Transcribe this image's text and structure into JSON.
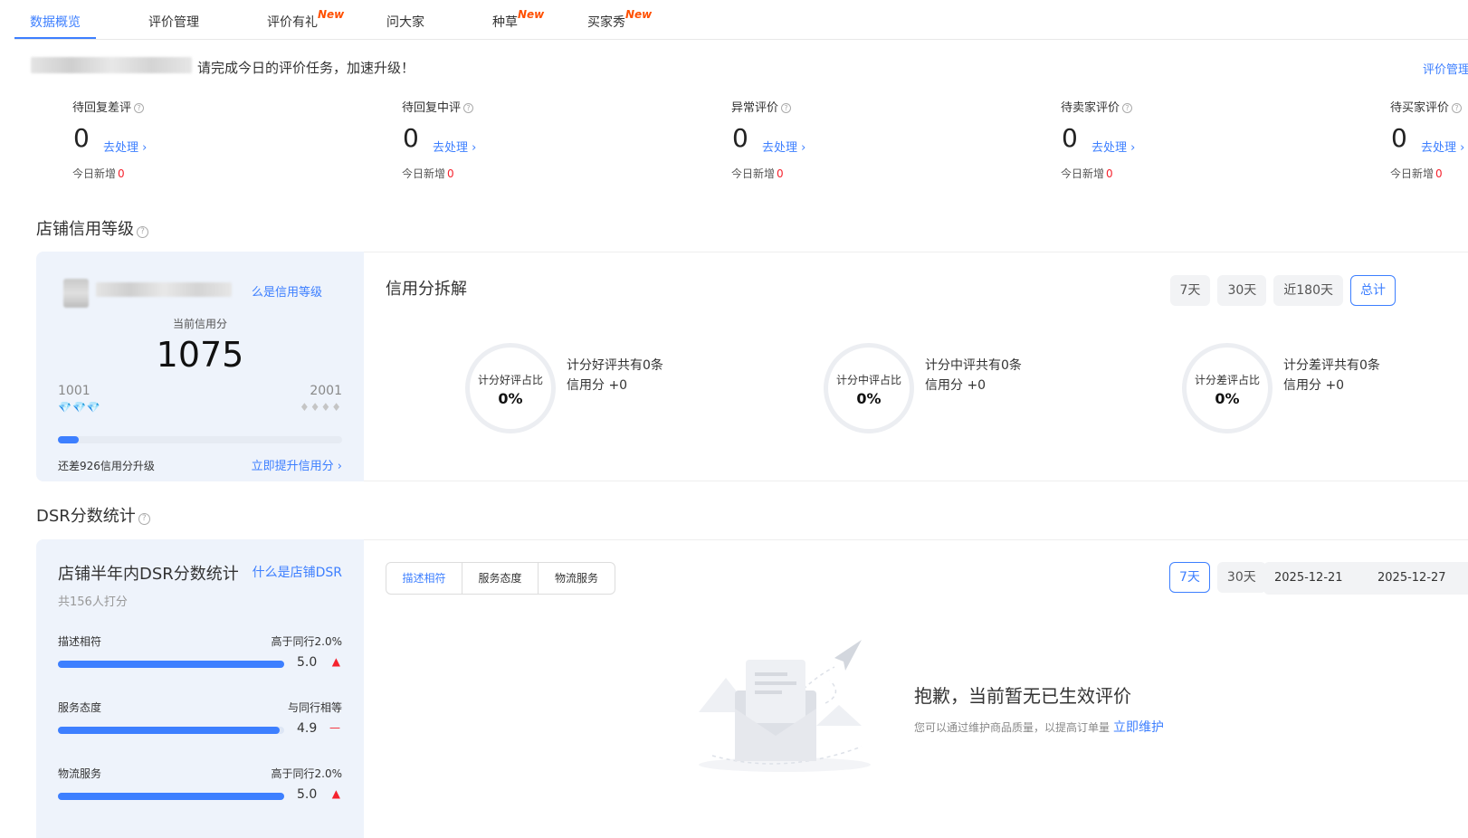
{
  "tabs": [
    {
      "label": "数据概览",
      "new": ""
    },
    {
      "label": "评价管理",
      "new": ""
    },
    {
      "label": "评价有礼",
      "new": "New"
    },
    {
      "label": "问大家",
      "new": ""
    },
    {
      "label": "种草",
      "new": "New"
    },
    {
      "label": "买家秀",
      "new": "New"
    }
  ],
  "notice": {
    "text": "请完成今日的评价任务，加速升级！",
    "link": "评价管理"
  },
  "stats": [
    {
      "label": "待回复差评",
      "value": "0",
      "action": "去处理 ›",
      "today_label": "今日新增",
      "today_value": "0"
    },
    {
      "label": "待回复中评",
      "value": "0",
      "action": "去处理 ›",
      "today_label": "今日新增",
      "today_value": "0"
    },
    {
      "label": "异常评价",
      "value": "0",
      "action": "去处理 ›",
      "today_label": "今日新增",
      "today_value": "0"
    },
    {
      "label": "待卖家评价",
      "value": "0",
      "action": "去处理 ›",
      "today_label": "今日新增",
      "today_value": "0"
    },
    {
      "label": "待买家评价",
      "value": "0",
      "action": "去处理 ›",
      "today_label": "今日新增",
      "today_value": "0"
    }
  ],
  "credit": {
    "section_title": "店铺信用等级",
    "what_link": "么是信用等级",
    "current_label": "当前信用分",
    "current_score": "1075",
    "level_min": "1001",
    "level_max": "2001",
    "progress_fraction": 0.074,
    "remaining_text": "还差926信用分升级",
    "improve_link": "立即提升信用分 ›"
  },
  "breakdown": {
    "title": "信用分拆解",
    "ranges": [
      "7天",
      "30天",
      "近180天",
      "总计"
    ],
    "active_range": "总计",
    "items": [
      {
        "ring_label": "计分好评占比",
        "ring_value": "0%",
        "line1": "计分好评共有0条",
        "line2": "信用分 +0"
      },
      {
        "ring_label": "计分中评占比",
        "ring_value": "0%",
        "line1": "计分中评共有0条",
        "line2": "信用分 +0"
      },
      {
        "ring_label": "计分差评占比",
        "ring_value": "0%",
        "line1": "计分差评共有0条",
        "line2": "信用分 +0"
      }
    ]
  },
  "dsr": {
    "section_title": "DSR分数统计",
    "head": "店铺半年内DSR分数统计",
    "what_link": "什么是店铺DSR",
    "count": "共156人打分",
    "metrics": [
      {
        "name": "描述相符",
        "compare": "高于同行2.0%",
        "score": "5.0",
        "fraction": 1.0,
        "trend": "▲"
      },
      {
        "name": "服务态度",
        "compare": "与同行相等",
        "score": "4.9",
        "fraction": 0.98,
        "trend": "—"
      },
      {
        "name": "物流服务",
        "compare": "高于同行2.0%",
        "score": "5.0",
        "fraction": 1.0,
        "trend": "▲"
      }
    ],
    "segments": [
      "描述相符",
      "服务态度",
      "物流服务"
    ],
    "ranges": [
      "7天",
      "30天"
    ],
    "date_start": "2025-12-21",
    "date_end": "2025-12-27",
    "empty_title": "抱歉，当前暂无已生效评价",
    "empty_sub": "您可以通过维护商品质量，以提高订单量",
    "empty_link": "立即维护"
  }
}
